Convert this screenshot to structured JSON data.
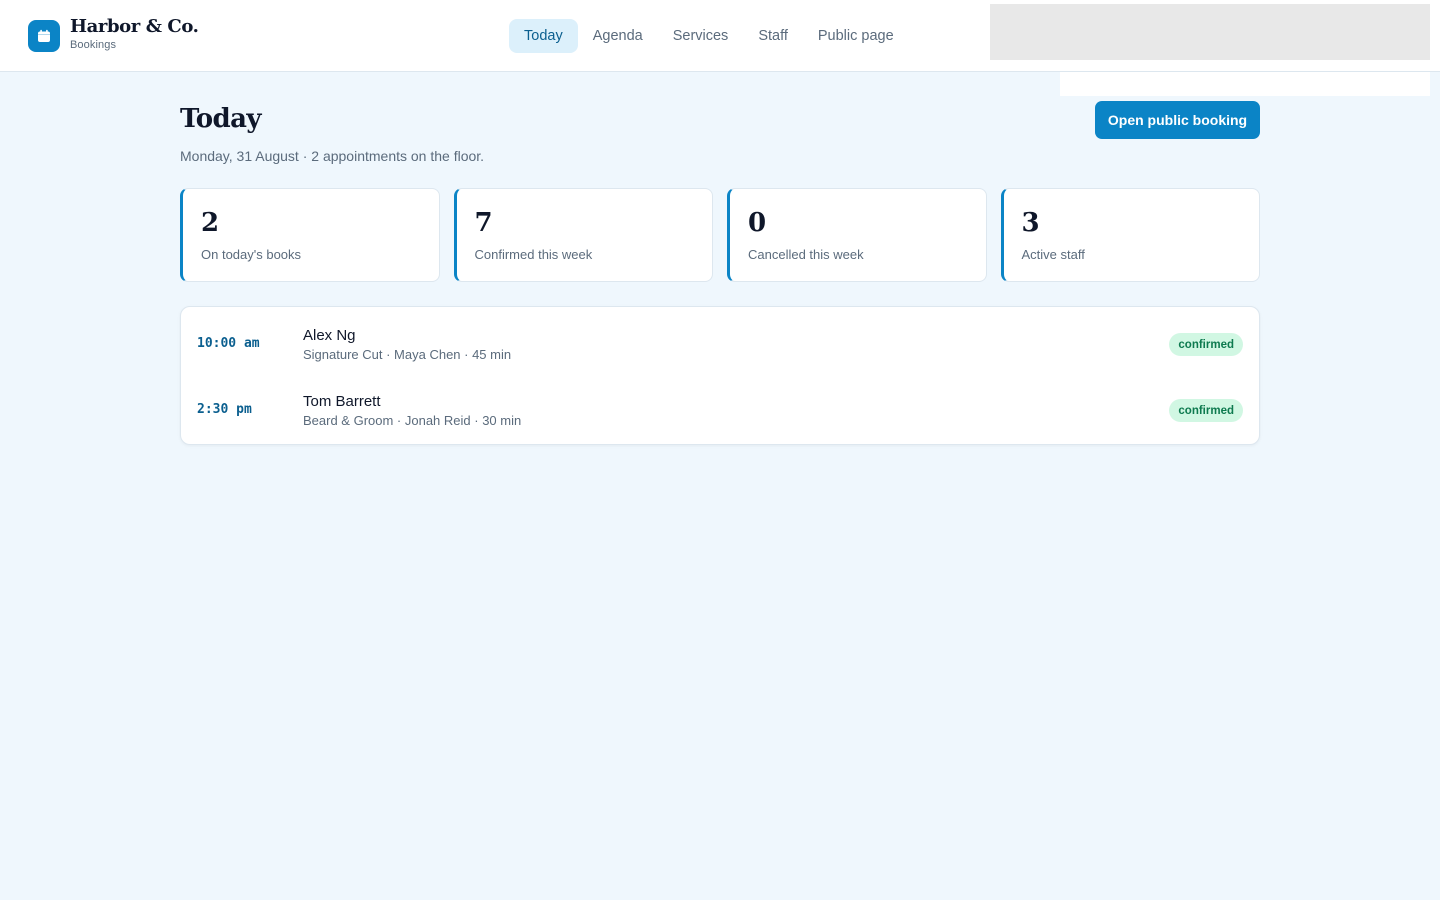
{
  "brand": {
    "name": "Harbor & Co.",
    "subtitle": "Bookings",
    "icon": "calendar-icon",
    "color": "#0b84c6"
  },
  "nav": {
    "items": [
      {
        "label": "Today",
        "active": true
      },
      {
        "label": "Agenda",
        "active": false
      },
      {
        "label": "Services",
        "active": false
      },
      {
        "label": "Staff",
        "active": false
      },
      {
        "label": "Public page",
        "active": false
      }
    ]
  },
  "page": {
    "title": "Today",
    "subtitle": "Monday, 31 August · 2 appointments on the floor.",
    "primary_action": "Open public booking"
  },
  "stats": [
    {
      "value": "2",
      "label": "On today's books"
    },
    {
      "value": "7",
      "label": "Confirmed this week"
    },
    {
      "value": "0",
      "label": "Cancelled this week"
    },
    {
      "value": "3",
      "label": "Active staff"
    }
  ],
  "appointments": [
    {
      "time": "10:00 am",
      "client": "Alex Ng",
      "detail": "Signature Cut · Maya Chen · 45 min",
      "status": "confirmed"
    },
    {
      "time": "2:30 pm",
      "client": "Tom Barrett",
      "detail": "Beard & Groom · Jonah Reid · 30 min",
      "status": "confirmed"
    }
  ],
  "colors": {
    "accent": "#0b84c6",
    "background": "#eff7fd",
    "status_confirmed_bg": "#d1f7e3",
    "status_confirmed_text": "#0e7a4f"
  }
}
